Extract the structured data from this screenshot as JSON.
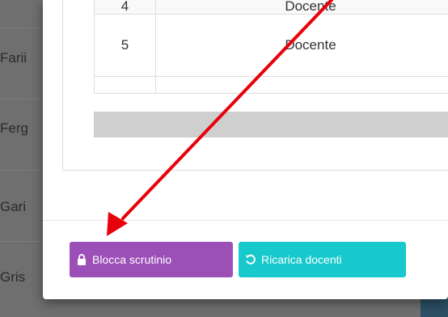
{
  "background": {
    "names": [
      "Farii",
      "Ferg",
      "Gari",
      "Gris"
    ]
  },
  "table": {
    "prev_row": {
      "num": "4",
      "role": "Docente"
    },
    "current_row": {
      "num": "5",
      "role": "Docente"
    }
  },
  "footer": {
    "lock_label": "Blocca scrutinio",
    "reload_label": "Ricarica docenti"
  },
  "colors": {
    "lock_button": "#9b4fb7",
    "reload_button": "#17c9cc",
    "arrow": "#e8000b"
  },
  "icons": {
    "lock": "lock-icon",
    "reload": "reload-icon"
  }
}
